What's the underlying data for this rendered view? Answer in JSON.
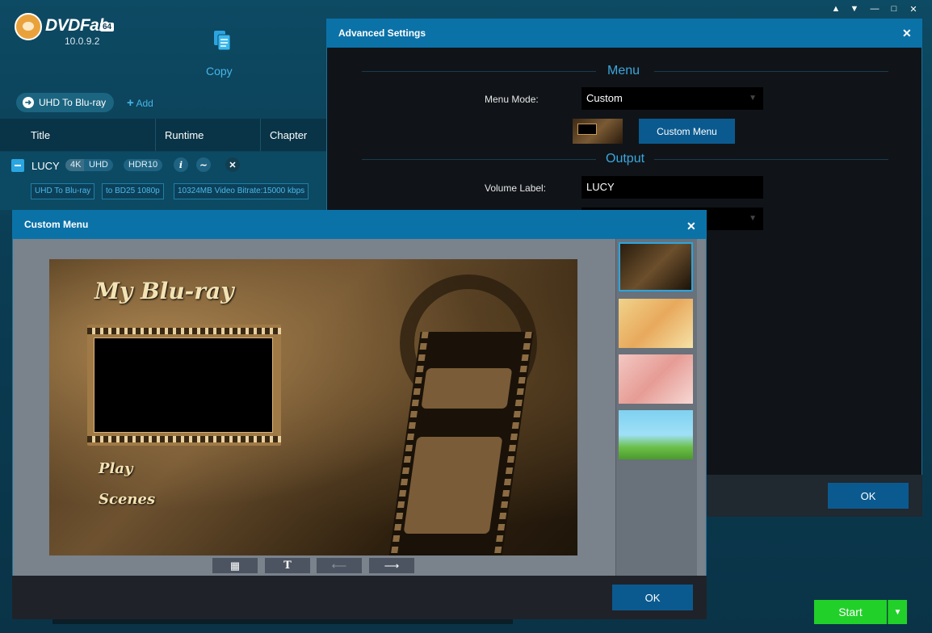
{
  "app": {
    "logo_text": "DVDFab",
    "logo_badge": "64",
    "version": "10.0.9.2",
    "module_label": "Copy",
    "mode": "UHD To Blu-ray",
    "add_label": "Add",
    "window_controls": [
      "shirt-icon",
      "menu-icon",
      "minimize-icon",
      "maximize-icon",
      "close-icon"
    ]
  },
  "table": {
    "columns": [
      "Title",
      "Runtime",
      "Chapter"
    ],
    "row": {
      "title": "LUCY",
      "tag_4k": "4K",
      "tag_uhd": "UHD",
      "tag_hdr": "HDR10",
      "chips": [
        "UHD To Blu-ray",
        "to BD25 1080p",
        "10324MB Video Bitrate:15000 kbps"
      ]
    }
  },
  "advanced_settings": {
    "title": "Advanced Settings",
    "menu_section": "Menu",
    "menu_mode_label": "Menu Mode:",
    "menu_mode_value": "Custom",
    "custom_menu_button": "Custom Menu",
    "output_section": "Output",
    "volume_label_label": "Volume Label:",
    "volume_label_value": "LUCY",
    "ok_label": "OK"
  },
  "custom_menu": {
    "title": "Custom Menu",
    "preview": {
      "heading": "My Blu-ray",
      "items": [
        "Play",
        "Scenes"
      ]
    },
    "toolbar": [
      "image-icon",
      "text-icon",
      "arrow-left-icon",
      "arrow-right-icon"
    ],
    "templates_count_visible": 4,
    "selected_template": 1,
    "ok_label": "OK"
  },
  "footer": {
    "start_label": "Start",
    "start_color": "#22d02a"
  },
  "colors": {
    "accent": "#0b72a8",
    "link": "#48b5e8"
  }
}
